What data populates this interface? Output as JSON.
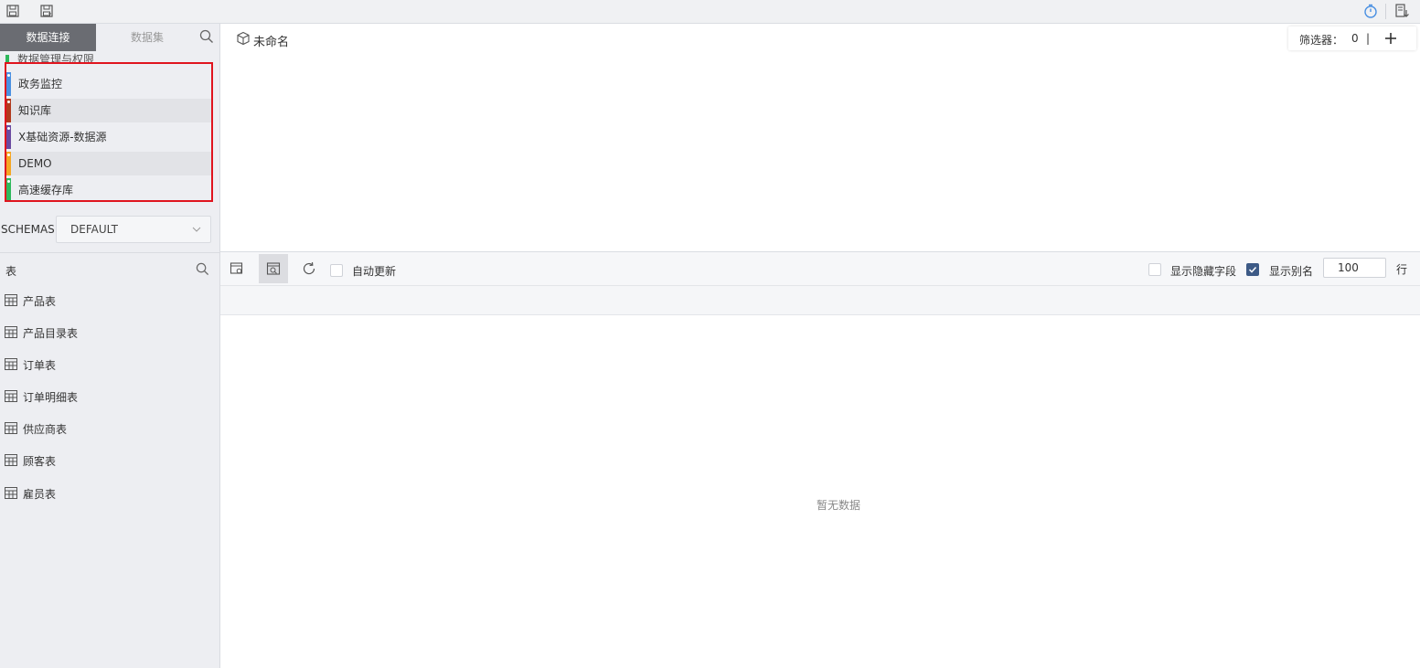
{
  "toolbar": {
    "save_icon": "save-icon",
    "save_as_icon": "save-as-icon",
    "timer_icon": "timer-icon",
    "export_icon": "export-icon"
  },
  "left": {
    "tabs": [
      {
        "label": "数据连接",
        "active": true
      },
      {
        "label": "数据集",
        "active": false
      }
    ],
    "partial_item": "数据管理与权限",
    "connections": [
      {
        "label": "政务监控",
        "color": "#4a90e2"
      },
      {
        "label": "知识库",
        "color": "#b03a1e"
      },
      {
        "label": "X基础资源-数据源",
        "color": "#6a4aa0"
      },
      {
        "label": "DEMO",
        "color": "#f5a623"
      },
      {
        "label": "高速缓存库",
        "color": "#2eb85c"
      }
    ],
    "schema": {
      "label": "SCHEMAS",
      "value": "DEFAULT"
    },
    "tables": {
      "header": "表",
      "items": [
        "产品表",
        "产品目录表",
        "订单表",
        "订单明细表",
        "供应商表",
        "顾客表",
        "雇员表"
      ]
    }
  },
  "main": {
    "title": "未命名",
    "filter": {
      "label": "筛选器：",
      "count": "0",
      "separator": "|"
    },
    "toolbar": {
      "auto_update": "自动更新",
      "show_hidden": "显示隐藏字段",
      "show_alias": "显示别名",
      "rows_value": "100",
      "rows_unit": "行"
    },
    "empty_text": "暂无数据"
  },
  "colors": {
    "highlight_border": "#e0141e",
    "active_tab": "#6a6c72",
    "checkbox_on": "#3d5a86",
    "timer_accent": "#4a90e2"
  }
}
